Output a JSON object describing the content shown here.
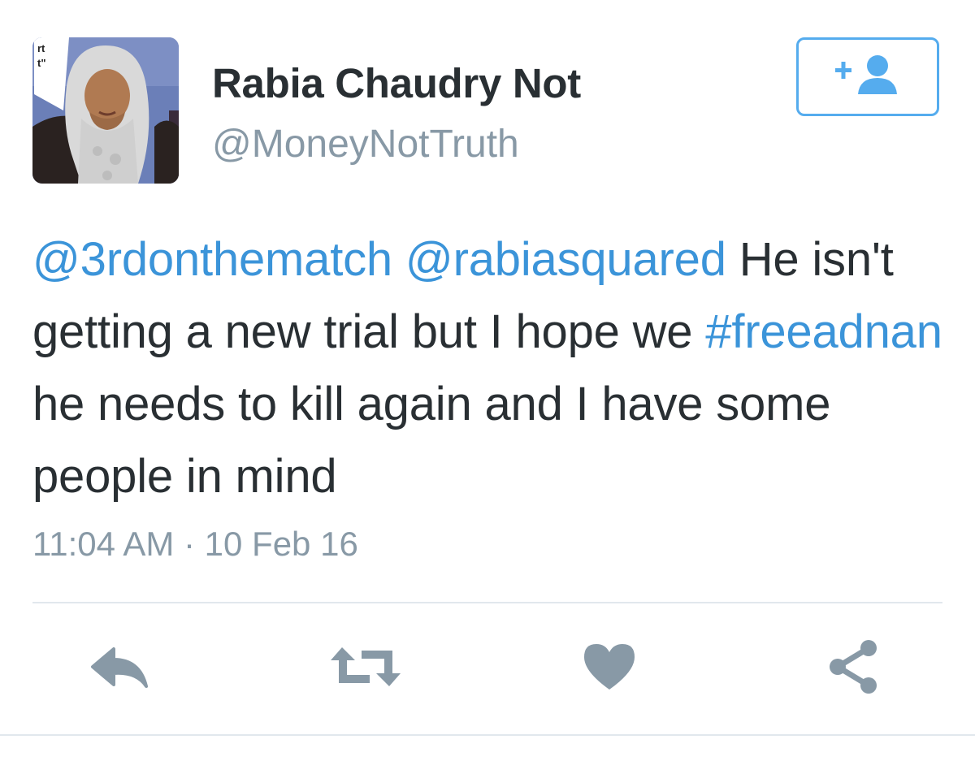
{
  "user": {
    "display_name": "Rabia Chaudry Not",
    "handle": "@MoneyNotTruth"
  },
  "tweet": {
    "segments": [
      {
        "text": "@3rdonthematch",
        "type": "mention"
      },
      {
        "text": " ",
        "type": "text"
      },
      {
        "text": "@rabiasquared",
        "type": "mention"
      },
      {
        "text": " He isn't getting a new trial but I hope we ",
        "type": "text"
      },
      {
        "text": "#freeadnan",
        "type": "hashtag"
      },
      {
        "text": " he needs to kill again and I have some people in mind",
        "type": "text"
      }
    ],
    "timestamp": "11:04 AM · 10 Feb 16"
  },
  "actions": {
    "reply_icon": "reply-icon",
    "retweet_icon": "retweet-icon",
    "like_icon": "heart-icon",
    "share_icon": "share-icon",
    "follow_icon": "add-user-icon"
  },
  "colors": {
    "link": "#3b94d9",
    "text": "#292f33",
    "muted": "#8899a6",
    "accent": "#55acee",
    "action_icon": "#8899a6"
  }
}
